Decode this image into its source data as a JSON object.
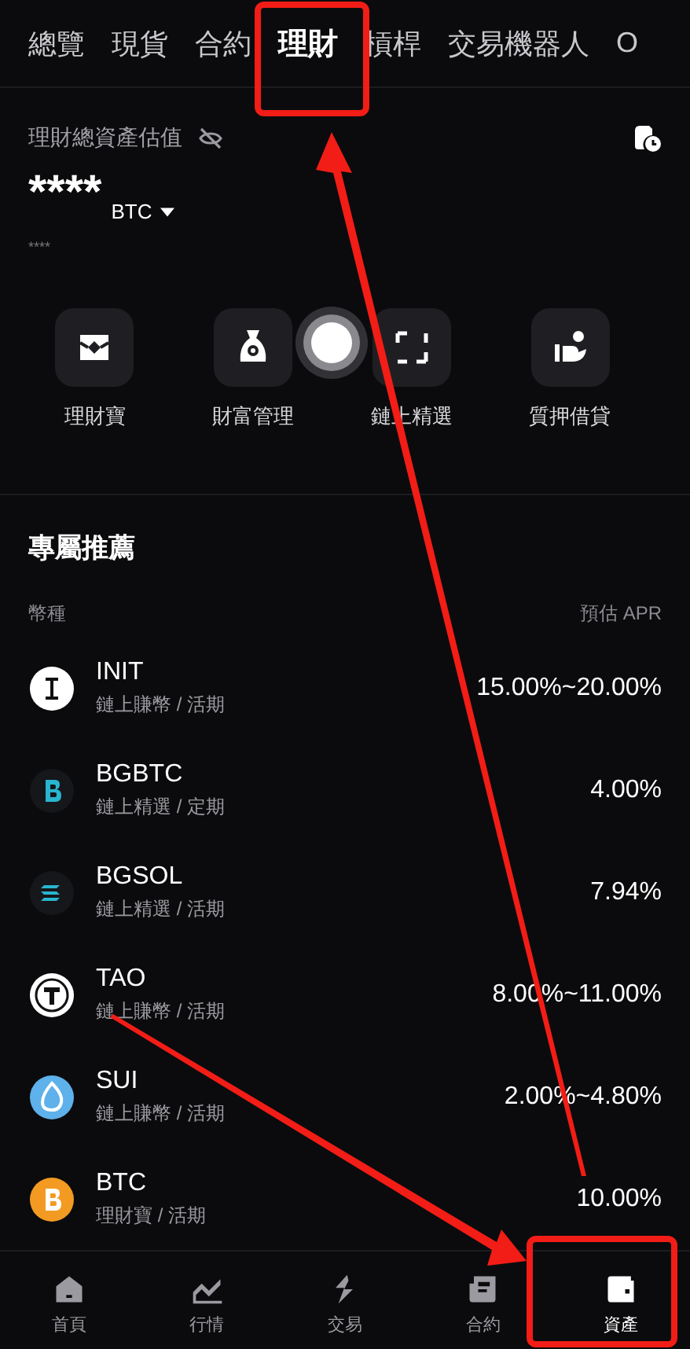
{
  "tabs": [
    {
      "label": "總覽",
      "selected": false
    },
    {
      "label": "現貨",
      "selected": false
    },
    {
      "label": "合約",
      "selected": false
    },
    {
      "label": "理財",
      "selected": true
    },
    {
      "label": "槓桿",
      "selected": false
    },
    {
      "label": "交易機器人",
      "selected": false
    },
    {
      "label": "O",
      "selected": false
    }
  ],
  "assets": {
    "label": "理財總資產估值",
    "value": "****",
    "unit": "BTC",
    "sub_value": "****"
  },
  "quick_actions": [
    {
      "label": "理財寶"
    },
    {
      "label": "財富管理"
    },
    {
      "label": "鏈上精選"
    },
    {
      "label": "質押借貸"
    }
  ],
  "recommend": {
    "title": "專屬推薦",
    "column_1": "幣種",
    "column_2": "預估 APR",
    "rows": [
      {
        "name": "INIT",
        "type": "鏈上賺幣 / 活期",
        "apr": "15.00%~20.00%"
      },
      {
        "name": "BGBTC",
        "type": "鏈上精選 / 定期",
        "apr": "4.00%"
      },
      {
        "name": "BGSOL",
        "type": "鏈上精選 / 活期",
        "apr": "7.94%"
      },
      {
        "name": "TAO",
        "type": "鏈上賺幣 / 活期",
        "apr": "8.00%~11.00%"
      },
      {
        "name": "SUI",
        "type": "鏈上賺幣 / 活期",
        "apr": "2.00%~4.80%"
      },
      {
        "name": "BTC",
        "type": "理財寶 / 活期",
        "apr": "10.00%"
      }
    ]
  },
  "bottom_nav": [
    {
      "label": "首頁",
      "selected": false
    },
    {
      "label": "行情",
      "selected": false
    },
    {
      "label": "交易",
      "selected": false
    },
    {
      "label": "合約",
      "selected": false
    },
    {
      "label": "資產",
      "selected": true
    }
  ]
}
